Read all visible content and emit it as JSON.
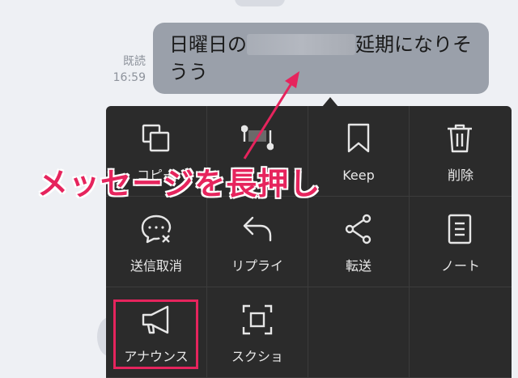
{
  "chat": {
    "read_status": "既読",
    "time": "16:59",
    "message_before": "日曜日の",
    "message_after": "延期になりそうう"
  },
  "menu": {
    "items": [
      {
        "label": "コピー",
        "icon": "copy-icon"
      },
      {
        "label": "",
        "icon": "select-text-icon"
      },
      {
        "label": "Keep",
        "icon": "bookmark-icon"
      },
      {
        "label": "削除",
        "icon": "trash-icon"
      },
      {
        "label": "送信取消",
        "icon": "unsend-icon"
      },
      {
        "label": "リプライ",
        "icon": "reply-icon"
      },
      {
        "label": "転送",
        "icon": "share-icon"
      },
      {
        "label": "ノート",
        "icon": "note-icon"
      },
      {
        "label": "アナウンス",
        "icon": "megaphone-icon"
      },
      {
        "label": "スクショ",
        "icon": "screenshot-icon"
      }
    ]
  },
  "annotation": {
    "text": "メッセージを長押し",
    "color": "#e6245d"
  }
}
